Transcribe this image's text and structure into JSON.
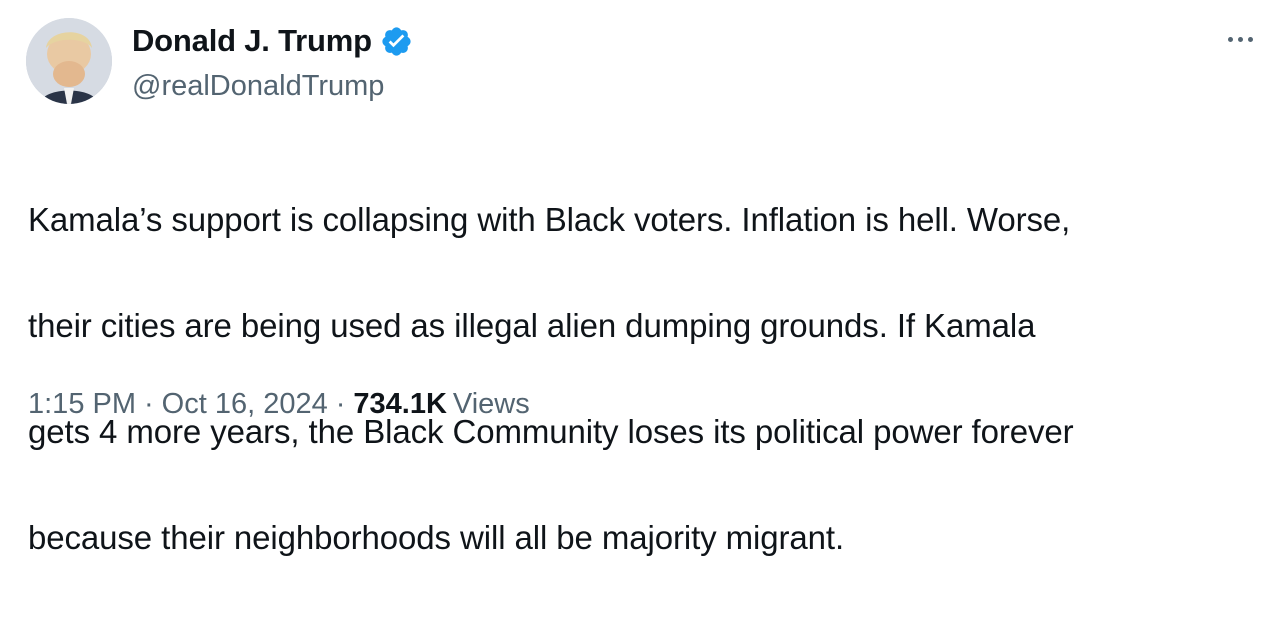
{
  "tweet": {
    "author": {
      "display_name": "Donald J. Trump",
      "handle": "@realDonaldTrump",
      "verified": true,
      "verified_color": "#1d9bf0"
    },
    "text_lines": [
      "Kamala’s support is collapsing with Black voters. Inflation is hell. Worse,",
      "their cities are being used as illegal alien dumping grounds. If Kamala",
      "gets 4 more years, the Black Community loses its political power forever",
      "because their neighborhoods will all be majority migrant."
    ],
    "time": "1:15 PM",
    "date": "Oct 16, 2024",
    "separator": "·",
    "views_count": "734.1K",
    "views_label": "Views",
    "more_icon": "more-horizontal-icon"
  }
}
